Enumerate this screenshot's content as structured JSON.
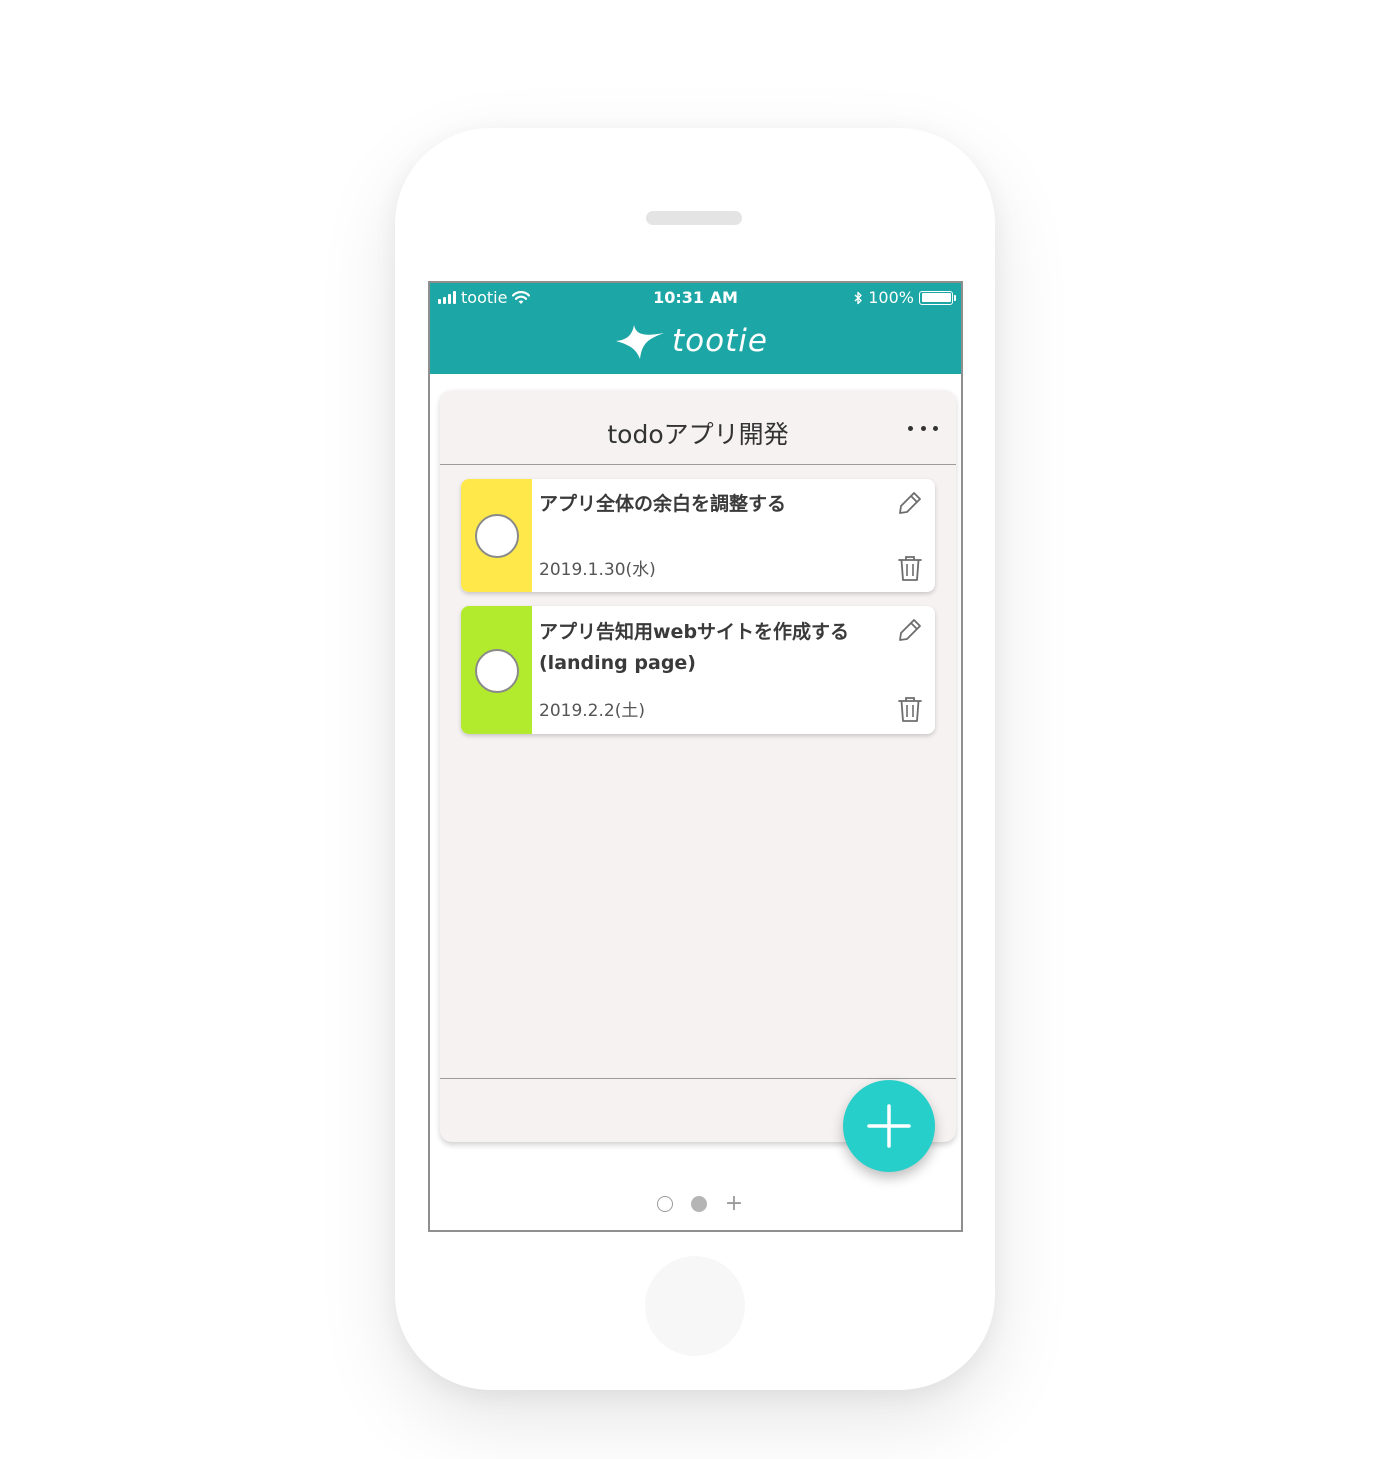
{
  "status_bar": {
    "carrier": "tootie",
    "time": "10:31 AM",
    "battery": "100%"
  },
  "app": {
    "logo_text": "tootie",
    "accent_color": "#1ca6a5"
  },
  "board": {
    "title": "todoアプリ開発",
    "tasks": [
      {
        "title": "アプリ全体の余白を調整する",
        "date": "2019.1.30(水)",
        "color": "#ffe94a"
      },
      {
        "title": "アプリ告知用webサイトを作成する(landing page)",
        "date": "2019.2.2(土)",
        "color": "#b2eb2e"
      }
    ]
  },
  "fab": {
    "color": "#26cfc9",
    "icon": "plus-icon"
  },
  "pager": {
    "pages": 2,
    "current": 2
  }
}
